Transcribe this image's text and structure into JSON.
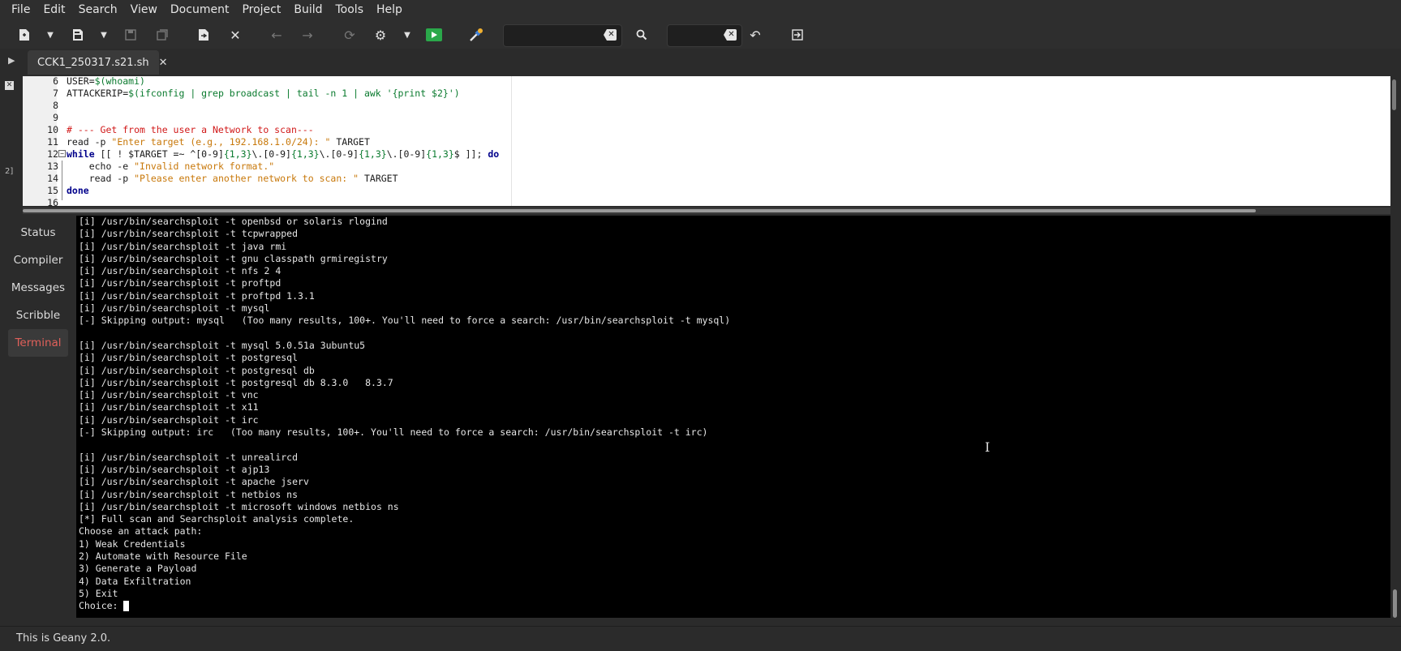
{
  "menubar": {
    "items": [
      "File",
      "Edit",
      "Search",
      "View",
      "Document",
      "Project",
      "Build",
      "Tools",
      "Help"
    ]
  },
  "toolbar": {
    "search_value": "",
    "goto_value": ""
  },
  "tabs": {
    "active_file": "CCK1_250317.s21.sh"
  },
  "sidebar": {
    "strip_number": "2]"
  },
  "editor": {
    "lines": [
      {
        "num": "6",
        "parts": [
          [
            "USER=",
            ""
          ],
          [
            "$(whoami)",
            "var"
          ]
        ]
      },
      {
        "num": "7",
        "parts": [
          [
            "ATTACKERIP=",
            ""
          ],
          [
            "$(ifconfig | grep broadcast | tail -n 1 | awk '{print $2}')",
            "var"
          ]
        ]
      },
      {
        "num": "8",
        "parts": []
      },
      {
        "num": "9",
        "parts": []
      },
      {
        "num": "10",
        "parts": [
          [
            "# --- Get from the user a Network to scan---",
            "cmt"
          ]
        ]
      },
      {
        "num": "11",
        "parts": [
          [
            "read -p ",
            ""
          ],
          [
            "\"Enter target (e.g., 192.168.1.0/24): \"",
            "str"
          ],
          [
            " TARGET",
            ""
          ]
        ]
      },
      {
        "num": "12",
        "parts": [
          [
            "while",
            "kw"
          ],
          [
            " [[ ! $TARGET =~ ^[0-9]",
            ""
          ],
          [
            "{1,3}",
            "var"
          ],
          [
            "\\.[0-9]",
            ""
          ],
          [
            "{1,3}",
            "var"
          ],
          [
            "\\.[0-9]",
            ""
          ],
          [
            "{1,3}",
            "var"
          ],
          [
            "\\.[0-9]",
            ""
          ],
          [
            "{1,3}",
            "var"
          ],
          [
            "$ ]]; ",
            ""
          ],
          [
            "do",
            "kw"
          ]
        ]
      },
      {
        "num": "13",
        "parts": [
          [
            "    echo -e ",
            ""
          ],
          [
            "\"Invalid network format.\"",
            "str"
          ]
        ]
      },
      {
        "num": "14",
        "parts": [
          [
            "    read -p ",
            ""
          ],
          [
            "\"Please enter another network to scan: \"",
            "str"
          ],
          [
            " TARGET",
            ""
          ]
        ]
      },
      {
        "num": "15",
        "parts": [
          [
            "done",
            "kw"
          ]
        ]
      },
      {
        "num": "16",
        "parts": []
      }
    ]
  },
  "message_tabs": [
    "Status",
    "Compiler",
    "Messages",
    "Scribble",
    "Terminal"
  ],
  "terminal": {
    "lines": [
      "[i] /usr/bin/searchsploit -t openbsd or solaris rlogind",
      "[i] /usr/bin/searchsploit -t tcpwrapped",
      "[i] /usr/bin/searchsploit -t java rmi",
      "[i] /usr/bin/searchsploit -t gnu classpath grmiregistry",
      "[i] /usr/bin/searchsploit -t nfs 2 4",
      "[i] /usr/bin/searchsploit -t proftpd",
      "[i] /usr/bin/searchsploit -t proftpd 1.3.1",
      "[i] /usr/bin/searchsploit -t mysql",
      "[-] Skipping output: mysql   (Too many results, 100+. You'll need to force a search: /usr/bin/searchsploit -t mysql)",
      "",
      "[i] /usr/bin/searchsploit -t mysql 5.0.51a 3ubuntu5",
      "[i] /usr/bin/searchsploit -t postgresql",
      "[i] /usr/bin/searchsploit -t postgresql db",
      "[i] /usr/bin/searchsploit -t postgresql db 8.3.0   8.3.7",
      "[i] /usr/bin/searchsploit -t vnc",
      "[i] /usr/bin/searchsploit -t x11",
      "[i] /usr/bin/searchsploit -t irc",
      "[-] Skipping output: irc   (Too many results, 100+. You'll need to force a search: /usr/bin/searchsploit -t irc)",
      "",
      "[i] /usr/bin/searchsploit -t unrealircd",
      "[i] /usr/bin/searchsploit -t ajp13",
      "[i] /usr/bin/searchsploit -t apache jserv",
      "[i] /usr/bin/searchsploit -t netbios ns",
      "[i] /usr/bin/searchsploit -t microsoft windows netbios ns",
      "[*] Full scan and Searchsploit analysis complete.",
      "Choose an attack path:",
      "1) Weak Credentials",
      "2) Automate with Resource File",
      "3) Generate a Payload",
      "4) Data Exfiltration",
      "5) Exit"
    ],
    "prompt": "Choice: "
  },
  "statusbar": {
    "text": "This is Geany 2.0."
  },
  "colors": {
    "terminal_tab_active": "#e0605a",
    "run_button": "#2aa84a",
    "string": "#c8780a",
    "variable": "#0a7a2e",
    "comment": "#d11919",
    "keyword": "#00008b"
  }
}
